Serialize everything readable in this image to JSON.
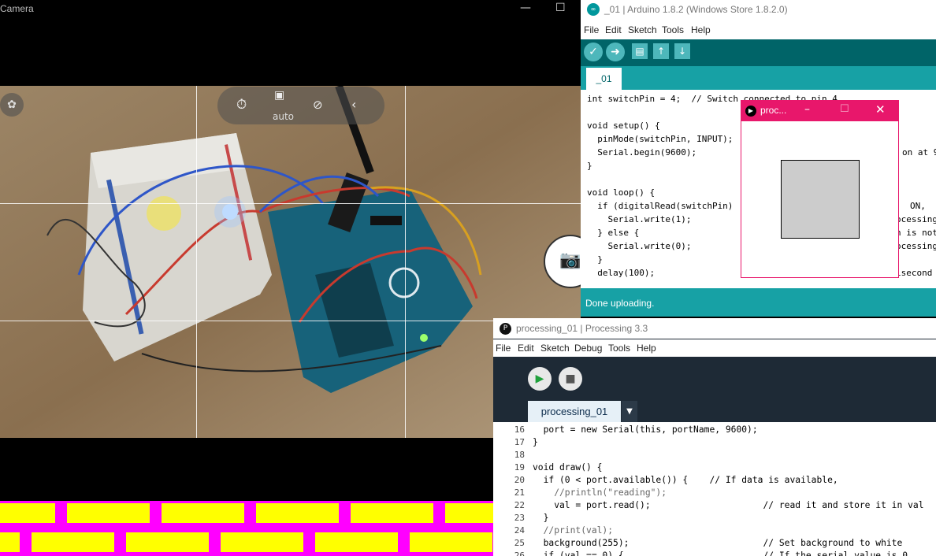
{
  "camera": {
    "title": "Camera",
    "auto_label": "auto",
    "icons": [
      "timer-icon",
      "photo-mode-icon",
      "exposure-icon",
      "collapse-chevron-icon",
      "shutter-camera-icon"
    ]
  },
  "arduino": {
    "title": "_01 | Arduino 1.8.2 (Windows Store 1.8.2.0)",
    "menu": [
      "File",
      "Edit",
      "Sketch",
      "Tools",
      "Help"
    ],
    "tab": "_01",
    "code_lines": [
      "int switchPin = 4;  // Switch connected to pin 4",
      "",
      "void setup() {",
      "  pinMode(switchPin, INPUT);",
      "  Serial.begin(9600);",
      "}",
      "",
      "void loop() {",
      "  if (digitalRead(switchPin)",
      "    Serial.write(1);",
      "  } else {",
      "    Serial.write(0);",
      "  }",
      "  delay(100);"
    ],
    "right_fragments": [
      "on at 9",
      "ON,",
      "ocessing",
      "h is not",
      "ocessing",
      "isecond"
    ],
    "status": "Done uploading.",
    "accent": "#17a1a5"
  },
  "popup": {
    "title": "proc...",
    "accent": "#e8176b",
    "square_color": "#cccccc"
  },
  "processing": {
    "title": "processing_01 | Processing 3.3",
    "menu": [
      "File",
      "Edit",
      "Sketch",
      "Debug",
      "Tools",
      "Help"
    ],
    "tab": "processing_01",
    "line_numbers": [
      "16",
      "17",
      "18",
      "19",
      "20",
      "21",
      "22",
      "23",
      "24",
      "25",
      "26"
    ],
    "code_lines": [
      "  port = new Serial(this, portName, 9600);",
      "}",
      "",
      "void draw() {",
      "  if (0 < port.available()) {    // If data is available,",
      "    //println(\"reading\");",
      "    val = port.read();                     // read it and store it in val",
      "  }",
      "  //print(val);",
      "  background(255);                         // Set background to white",
      "  if (val == 0) {                          // If the serial value is 0,"
    ]
  }
}
